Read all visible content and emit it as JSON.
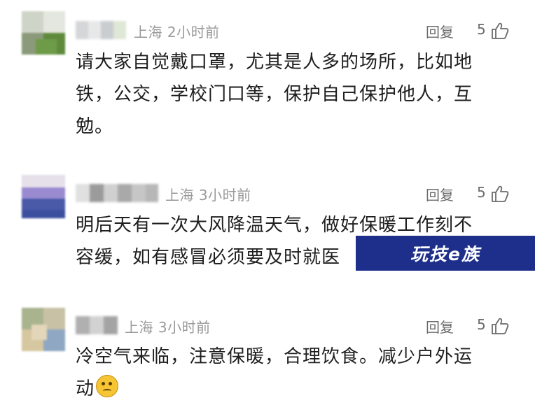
{
  "comments": [
    {
      "location": "上海",
      "time": "2小时前",
      "reply_label": "回复",
      "likes": "5",
      "text_lines": [
        "请大家自觉戴口罩，尤其是人多的场所，比如地",
        "铁，公交，学校门口等，保护自己保护他人，互",
        "勉。"
      ]
    },
    {
      "location": "上海",
      "time": "3小时前",
      "reply_label": "回复",
      "likes": "5",
      "text_lines": [
        "明后天有一次大风降温天气，做好保暖工作刻不",
        "容缓，如有感冒必须要及时就医"
      ]
    },
    {
      "location": "上海",
      "time": "3小时前",
      "reply_label": "回复",
      "likes": "5",
      "text_lines": [
        "冷空气来临，注意保暖，合理饮食。减少户外运",
        "动"
      ]
    }
  ],
  "watermark": {
    "text": "玩技e族"
  },
  "icons": {
    "like": "thumbs-up-icon",
    "emoji": "thinking-face-emoji-icon"
  },
  "colors": {
    "meta_text": "#9a9a9a",
    "body_text": "#1e1e1e",
    "watermark_bg": "#1d2f8a"
  }
}
